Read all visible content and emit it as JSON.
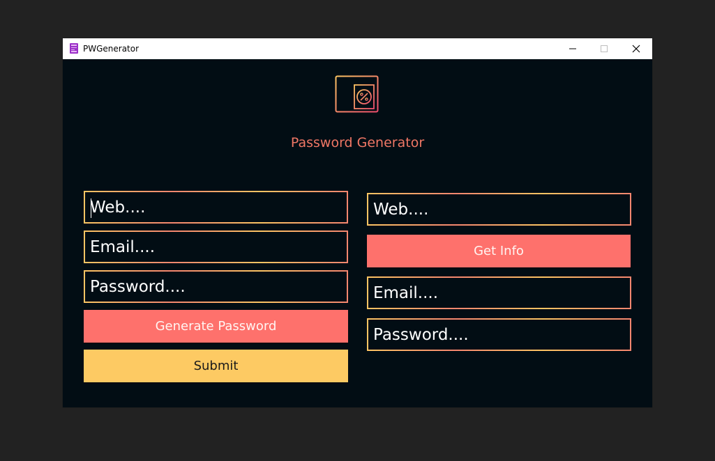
{
  "window": {
    "title": "PWGenerator"
  },
  "main": {
    "heading": "Password Generator"
  },
  "left_form": {
    "web_placeholder": "Web....",
    "email_placeholder": "Email....",
    "password_placeholder": "Password....",
    "generate_label": "Generate Password",
    "submit_label": "Submit"
  },
  "right_form": {
    "web_placeholder": "Web....",
    "get_info_label": "Get Info",
    "email_placeholder": "Email....",
    "password_placeholder": "Password...."
  },
  "icons": {
    "app": "app-icon",
    "logo": "password-document-icon",
    "minimize": "minimize-icon",
    "maximize": "maximize-icon",
    "close": "close-icon"
  },
  "colors": {
    "background": "#020d14",
    "accent_coral": "#fe716c",
    "accent_yellow": "#fdca63",
    "heading": "#f07765"
  }
}
